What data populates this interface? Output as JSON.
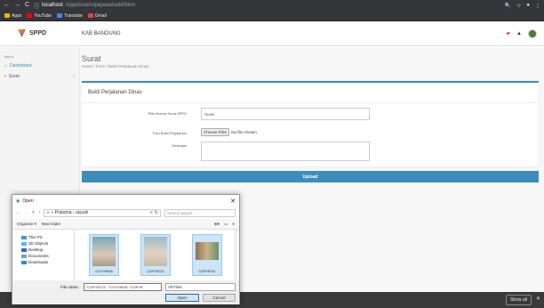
{
  "browser": {
    "nav": [
      "←",
      "→",
      "C"
    ],
    "url_host": "localhost",
    "url_path": "/sppd/users/pejawai/add/form",
    "bookmarks": [
      {
        "label": "Apps",
        "color": "#f4b400"
      },
      {
        "label": "YouTube",
        "color": "#ff0000"
      },
      {
        "label": "Translate",
        "color": "#4285f4"
      },
      {
        "label": "Gmail",
        "color": "#ea4335"
      }
    ]
  },
  "header": {
    "brand": "SPPD",
    "org": "KAB BANDUNG"
  },
  "sidebar": {
    "section": "Menu",
    "items": [
      {
        "label": "Dashboard"
      },
      {
        "label": "Surat"
      }
    ]
  },
  "page": {
    "title": "Surat",
    "breadcrumb": "Home / Form / Bukti Perjalanan Dinas"
  },
  "form": {
    "card_title": "Bukti Perjalanan Dinas",
    "field1_label": "Pilih Nomor Surat SPPD",
    "field1_value": "Surat",
    "field2_label": "Foto Bukti Perjalanan",
    "choose_files": "Choose Files",
    "no_file": "No file chosen",
    "field3_label": "Deskripsi",
    "upload": "Upload"
  },
  "download_bar": {
    "show_all": "Show all",
    "close": "✕"
  },
  "dialog": {
    "title": "Open",
    "close": "✕",
    "path": "« Pratama › aisyah",
    "search_placeholder": "Search aisyah",
    "organize": "Organize ▾",
    "new_folder": "New folder",
    "tree": [
      "This PC",
      "3D Objects",
      "Desktop",
      "Documents",
      "Downloads"
    ],
    "files": [
      "COYY9908",
      "COPY8721",
      "COPY8721"
    ],
    "filename_label": "File name:",
    "filename_value": "\"COPY8721\" \"COYY9908\" \"COPY8",
    "filetype": "All Files",
    "open": "Open",
    "cancel": "Cancel"
  }
}
